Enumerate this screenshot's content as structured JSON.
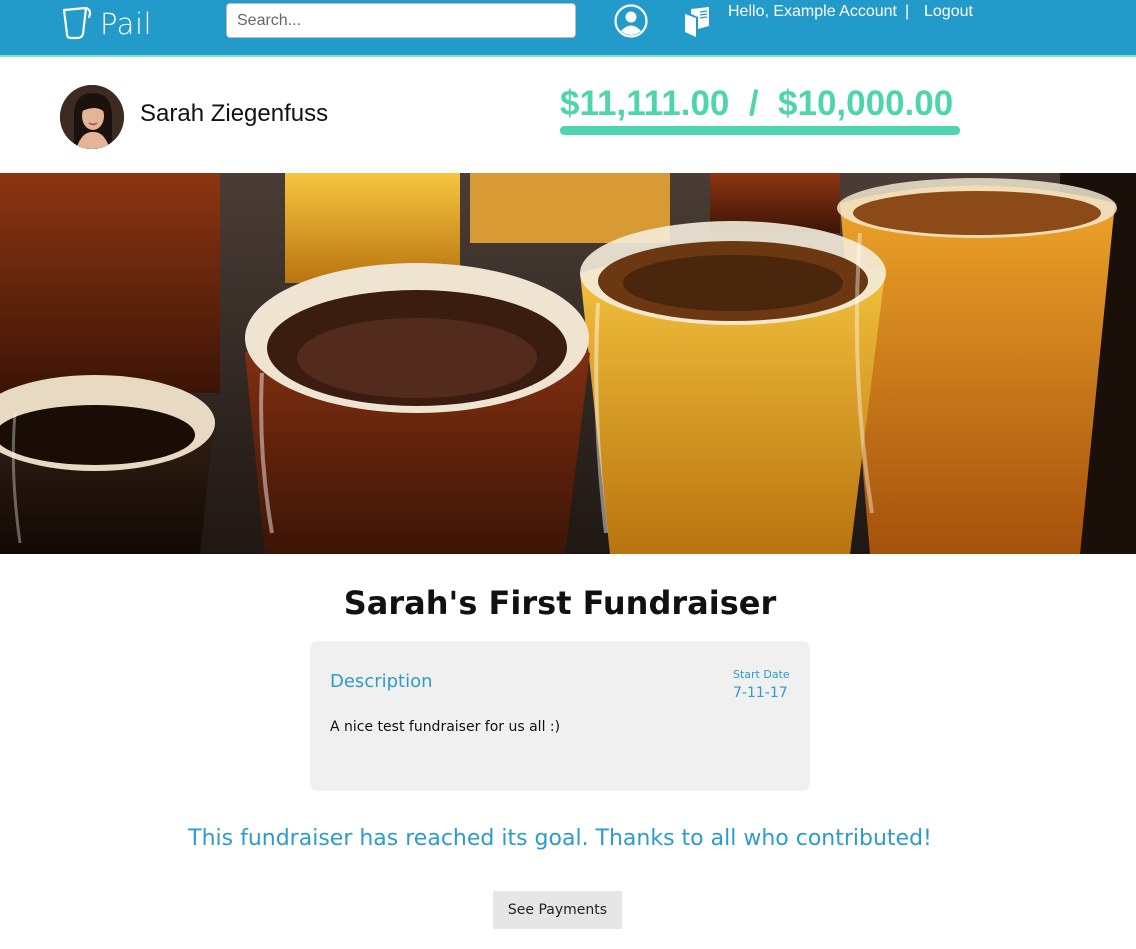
{
  "nav": {
    "logo_text": "Pail",
    "search_placeholder": "Search...",
    "greeting": "Hello, Example Account",
    "separator": "|",
    "logout_label": "Logout",
    "icons": [
      "pail-logo-icon",
      "user-icon",
      "book-icon"
    ]
  },
  "profile": {
    "name": "Sarah Ziegenfuss",
    "raised": "$11,111.00",
    "money_separator": "/",
    "goal": "$10,000.00",
    "progress_fraction": 1.0
  },
  "fundraiser": {
    "title": "Sarah's First Fundraiser",
    "description_heading": "Description",
    "start_date_label": "Start Date",
    "start_date": "7-11-17",
    "description": "A nice test fundraiser for us all :)",
    "goal_message": "This fundraiser has reached its goal. Thanks to all who contributed!",
    "payments_button": "See Payments"
  },
  "colors": {
    "nav_bg": "#229bcb",
    "accent_green": "#4fd5ae",
    "accent_blue": "#2d9bcb",
    "card_bg": "#f0f0f0"
  }
}
